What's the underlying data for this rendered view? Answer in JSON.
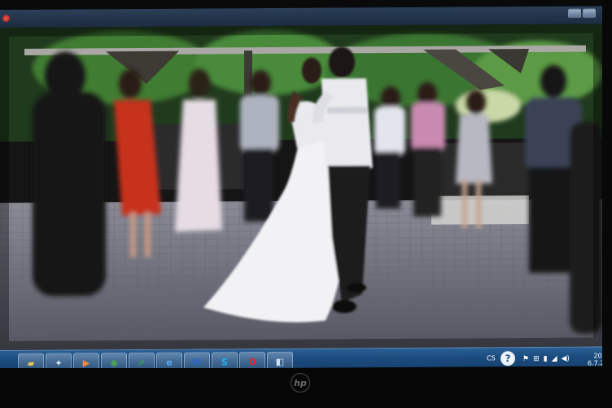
{
  "window": {
    "app_icon": "red-circle-icon"
  },
  "photo": {
    "subject_colors": {
      "dress": "#f2f2f4",
      "suit": "#1a1a1e",
      "shirt": "#e9e9ee",
      "red_dress": "#c7321f",
      "foliage": "#2f6a2a",
      "floor": "#6c6d77"
    }
  },
  "taskbar": {
    "color": "#1a4a7c",
    "pinned": [
      {
        "name": "folder-icon",
        "glyph": "▰",
        "color": "#f4c451"
      },
      {
        "name": "network-icon",
        "glyph": "✦",
        "color": "#dbe8ff"
      },
      {
        "name": "media-player-icon",
        "glyph": "▶",
        "color": "#ff8a1f"
      },
      {
        "name": "chrome-icon",
        "glyph": "◉",
        "color": "#4fa64b"
      },
      {
        "name": "green-app-icon",
        "glyph": "⇗",
        "color": "#2fa346"
      },
      {
        "name": "internet-explorer-icon",
        "glyph": "e",
        "color": "#59a8ef"
      },
      {
        "name": "word-icon",
        "glyph": "W",
        "color": "#2b65c8"
      },
      {
        "name": "skype-icon",
        "glyph": "S",
        "color": "#1cb0f0"
      },
      {
        "name": "opera-icon",
        "glyph": "O",
        "color": "#e4242c"
      },
      {
        "name": "photo-viewer-icon",
        "glyph": "◧",
        "color": "#cfe0f4"
      }
    ],
    "language": "CS",
    "help_glyph": "?",
    "tray_icons": [
      {
        "name": "flag-icon",
        "glyph": "⚑"
      },
      {
        "name": "windows-icon",
        "glyph": "⊞"
      },
      {
        "name": "battery-icon",
        "glyph": "▮"
      },
      {
        "name": "signal-icon",
        "glyph": "◢"
      },
      {
        "name": "volume-icon",
        "glyph": "◀)"
      }
    ],
    "clock_time": "20:",
    "clock_date": "6.7.2"
  },
  "monitor": {
    "brand": "hp"
  }
}
